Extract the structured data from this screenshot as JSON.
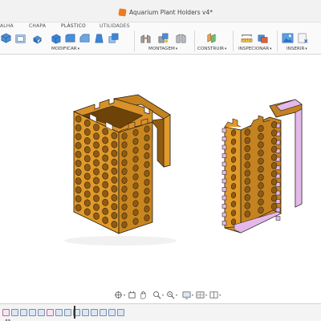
{
  "window": {
    "title": "Aquarium Plant Holders v4*"
  },
  "ribbon": {
    "tabs": [
      {
        "label": "ALHA"
      },
      {
        "label": "CHAPA"
      },
      {
        "label": "PLÁSTICO"
      },
      {
        "label": "UTILIDADES"
      }
    ],
    "groups": [
      {
        "label": "MODIFICAR",
        "caret": "▾"
      },
      {
        "label": "MONTAGEM",
        "caret": "▾"
      },
      {
        "label": "CONSTRUIR",
        "caret": "▾"
      },
      {
        "label": "INSPECIONAR",
        "caret": "▾"
      },
      {
        "label": "INSERIR",
        "caret": "▾"
      }
    ],
    "icons": [
      "extrude-icon",
      "shell-icon",
      "combine-icon",
      "press-pull-icon",
      "fillet-icon",
      "chamfer-icon",
      "draft-icon",
      "scale-icon",
      "joint-icon",
      "as-built-joint-icon",
      "joint-origin-icon",
      "offset-plane-icon",
      "measure-icon",
      "interference-icon",
      "insert-image-icon",
      "insert-mesh-icon"
    ]
  },
  "nav": {
    "icons": [
      "orbit-icon",
      "pan-icon",
      "hand-icon",
      "zoom-icon",
      "fit-icon",
      "display-settings-icon",
      "grid-icon",
      "viewports-icon"
    ]
  },
  "timeline": {
    "features": [
      "sketch",
      "extrude",
      "extrude",
      "extrude",
      "extrude",
      "sketch",
      "extrude",
      "extrude",
      "extrude",
      "extrude",
      "extrude",
      "pattern",
      "extrude",
      "extrude"
    ],
    "play_glyph": "◀ ▶"
  },
  "colors": {
    "body": "#e19a29",
    "body_shade": "#b4741b",
    "body_dark": "#8f5a12",
    "section_hatch": "#e5b8ec",
    "outline": "#1f1a14",
    "accent": "#2f6fb6"
  }
}
